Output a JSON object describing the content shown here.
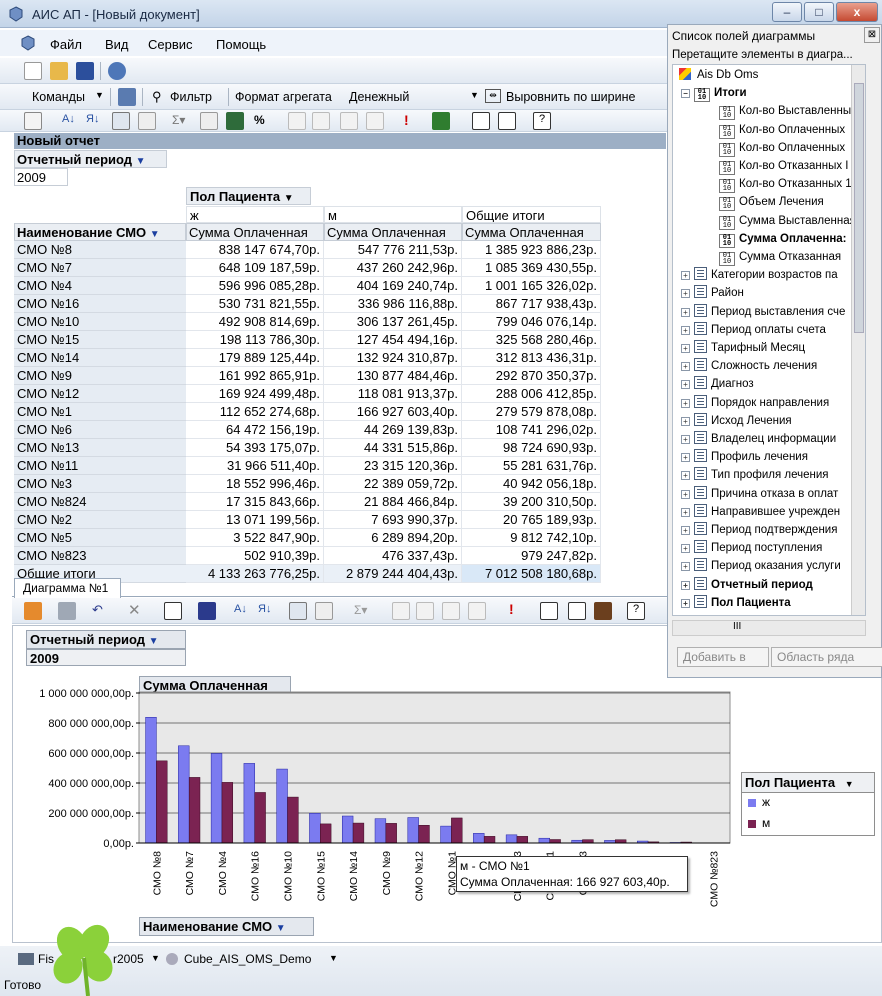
{
  "window": {
    "title": "АИС АП - [Новый документ]",
    "min": "–",
    "max": "□",
    "close": "x"
  },
  "menu": {
    "items": [
      "Файл",
      "Вид",
      "Сервис",
      "Помощь"
    ]
  },
  "toolbar2": {
    "commands": "Команды",
    "filter": "Фильтр",
    "agg_format": "Формат агрегата",
    "agg_value": "Денежный",
    "align": "Выровнить по ширине"
  },
  "report": {
    "title": "Новый отчет",
    "filter_field": "Отчетный период",
    "filter_value": "2009",
    "col_field": "Пол Пациента",
    "col_groups": [
      "ж",
      "м",
      "Общие итоги"
    ],
    "measure": "Сумма Оплаченная",
    "row_field": "Наименование СМО",
    "rows": [
      [
        "СМО №8",
        "838 147 674,70р.",
        "547 776 211,53р.",
        "1 385 923 886,23р."
      ],
      [
        "СМО №7",
        "648 109 187,59р.",
        "437 260 242,96р.",
        "1 085 369 430,55р."
      ],
      [
        "СМО №4",
        "596 996 085,28р.",
        "404 169 240,74р.",
        "1 001 165 326,02р."
      ],
      [
        "СМО №16",
        "530 731 821,55р.",
        "336 986 116,88р.",
        "867 717 938,43р."
      ],
      [
        "СМО №10",
        "492 908 814,69р.",
        "306 137 261,45р.",
        "799 046 076,14р."
      ],
      [
        "СМО №15",
        "198 113 786,30р.",
        "127 454 494,16р.",
        "325 568 280,46р."
      ],
      [
        "СМО №14",
        "179 889 125,44р.",
        "132 924 310,87р.",
        "312 813 436,31р."
      ],
      [
        "СМО №9",
        "161 992 865,91р.",
        "130 877 484,46р.",
        "292 870 350,37р."
      ],
      [
        "СМО №12",
        "169 924 499,48р.",
        "118 081 913,37р.",
        "288 006 412,85р."
      ],
      [
        "СМО №1",
        "112 652 274,68р.",
        "166 927 603,40р.",
        "279 579 878,08р."
      ],
      [
        "СМО №6",
        "64 472 156,19р.",
        "44 269 139,83р.",
        "108 741 296,02р."
      ],
      [
        "СМО №13",
        "54 393 175,07р.",
        "44 331 515,86р.",
        "98 724 690,93р."
      ],
      [
        "СМО №11",
        "31 966 511,40р.",
        "23 315 120,36р.",
        "55 281 631,76р."
      ],
      [
        "СМО №3",
        "18 552 996,46р.",
        "22 389 059,72р.",
        "40 942 056,18р."
      ],
      [
        "СМО №824",
        "17 315 843,66р.",
        "21 884 466,84р.",
        "39 200 310,50р."
      ],
      [
        "СМО №2",
        "13 071 199,56р.",
        "7 693 990,37р.",
        "20 765 189,93р."
      ],
      [
        "СМО №5",
        "3 522 847,90р.",
        "6 289 894,20р.",
        "9 812 742,10р."
      ],
      [
        "СМО №823",
        "502 910,39р.",
        "476 337,43р.",
        "979 247,82р."
      ]
    ],
    "total_label": "Общие итоги",
    "totals": [
      "4 133 263 776,25р.",
      "2 879 244 404,43р.",
      "7 012 508 180,68р."
    ]
  },
  "chart_tab": "Диаграмма №1",
  "chart_data": {
    "type": "bar",
    "title": "Сумма Оплаченная",
    "filter_label": "Отчетный период",
    "filter_value": "2009",
    "categories": [
      "СМО №8",
      "СМО №7",
      "СМО №4",
      "СМО №16",
      "СМО №10",
      "СМО №15",
      "СМО №14",
      "СМО №9",
      "СМО №12",
      "СМО №1",
      "СМО №6",
      "СМО №13",
      "СМО №11",
      "СМО №3",
      "СМО №824",
      "СМО №2",
      "СМО №5",
      "СМО №823"
    ],
    "visible_category_labels": [
      "СМО №8",
      "СМО №7",
      "СМО №4",
      "СМО №16",
      "СМО №10",
      "СМО №15",
      "СМО №14",
      "СМО №9",
      "СМО №12",
      "СМО №1",
      "",
      "СМО №13",
      "СМО №11",
      "СМО №3",
      "",
      "",
      "",
      "СМО №823"
    ],
    "series": [
      {
        "name": "ж",
        "color": "#7b7bf0",
        "values": [
          838147674.7,
          648109187.59,
          596996085.28,
          530731821.55,
          492908814.69,
          198113786.3,
          179889125.44,
          161992865.91,
          169924499.48,
          112652274.68,
          64472156.19,
          54393175.07,
          31966511.4,
          18552996.46,
          17315843.66,
          13071199.56,
          3522847.9,
          502910.39
        ]
      },
      {
        "name": "м",
        "color": "#7b2352",
        "values": [
          547776211.53,
          437260242.96,
          404169240.74,
          336986116.88,
          306137261.45,
          127454494.16,
          132924310.87,
          130877484.46,
          118081913.37,
          166927603.4,
          44269139.83,
          44331515.86,
          23315120.36,
          22389059.72,
          21884466.84,
          7693990.37,
          6289894.2,
          476337.43
        ]
      }
    ],
    "ylim": [
      0,
      1000000000
    ],
    "y_ticks": [
      "0,00р.",
      "200 000 000,00р.",
      "400 000 000,00р.",
      "600 000 000,00р.",
      "800 000 000,00р.",
      "1 000 000 000,00р."
    ],
    "xlabel": "Наименование СМО",
    "legend_title": "Пол Пациента",
    "legend_position": "right",
    "grid": true,
    "tooltip": [
      "м - СМО №1",
      "Сумма Оплаченная: 166 927 603,40р."
    ]
  },
  "fieldlist": {
    "title": "Список полей диаграммы",
    "hint": "Перетащите элементы в диагра...",
    "root": "Ais Db Oms",
    "group": "Итоги",
    "measures": [
      "Кол-во Выставленны",
      "Кол-во Оплаченных",
      "Кол-во Оплаченных",
      "Кол-во Отказанных I",
      "Кол-во Отказанных 1",
      "Объем Лечения",
      "Сумма Выставленная",
      "Сумма Оплаченна:",
      "Сумма Отказанная"
    ],
    "dims": [
      "Категории возрастов па",
      "Район",
      "Период выставления сче",
      "Период оплаты счета",
      "Тарифный Месяц",
      "Сложность лечения",
      "Диагноз",
      "Порядок направления",
      "Исход Лечения",
      "Владелец информации",
      "Профиль лечения",
      "Тип профиля лечения",
      "Причина отказа в оплат",
      "Направившее учрежден",
      "Период подтверждения",
      "Период поступления",
      "Период оказания услуги",
      "Отчетный период",
      "Пол Пациента"
    ],
    "add_btn": "Добавить в",
    "area_select": "Область ряда",
    "scroll_label": "III"
  },
  "status": {
    "db": "Fis",
    "db_suffix": "r2005",
    "cube": "Cube_AIS_OMS_Demo",
    "ready": "Готово"
  }
}
